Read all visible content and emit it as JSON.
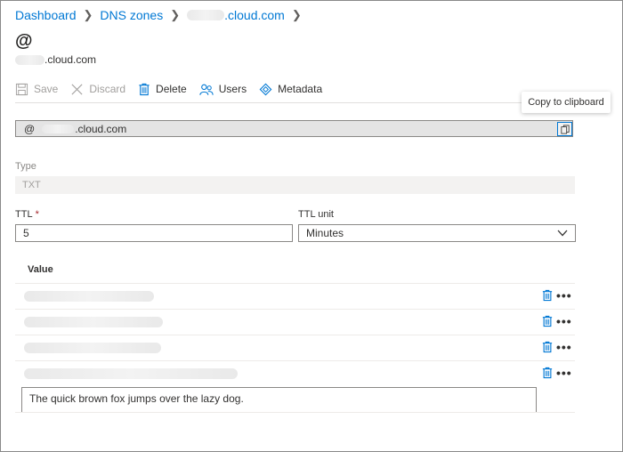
{
  "breadcrumb": {
    "items": [
      {
        "label": "Dashboard"
      },
      {
        "label": "DNS zones"
      },
      {
        "label": ".cloud.com"
      }
    ]
  },
  "header": {
    "title": "@",
    "subtitle": ".cloud.com"
  },
  "toolbar": {
    "save_label": "Save",
    "discard_label": "Discard",
    "delete_label": "Delete",
    "users_label": "Users",
    "metadata_label": "Metadata"
  },
  "name_field": {
    "prefix": "@",
    "suffix": ".cloud.com",
    "copy_tooltip": "Copy to clipboard"
  },
  "form": {
    "type_label": "Type",
    "type_value": "TXT",
    "ttl_label": "TTL",
    "ttl_required_marker": "*",
    "ttl_value": "5",
    "ttl_unit_label": "TTL unit",
    "ttl_unit_value": "Minutes"
  },
  "values": {
    "header": "Value",
    "rows": [
      {
        "text": ""
      },
      {
        "text": ""
      },
      {
        "text": ""
      },
      {
        "text": ""
      }
    ],
    "more_glyph": "•••",
    "new_value_text": "The quick brown fox jumps over the lazy dog."
  },
  "colors": {
    "accent": "#0078d4",
    "required": "#a4262c",
    "disabled": "#a19f9d"
  }
}
